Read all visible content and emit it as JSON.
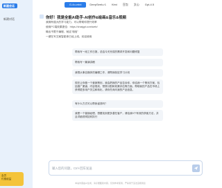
{
  "sidebar": {
    "active_item": "新建会话",
    "items": [
      {
        "label": "新建对话"
      }
    ],
    "badge": {
      "line1": "会员",
      "line2": "付费权益"
    }
  },
  "tabs": [
    {
      "label": "G-4o-mini",
      "active": true
    },
    {
      "label": "DeepSeek-r1",
      "active": false
    },
    {
      "label": "Kimi",
      "active": false
    },
    {
      "label": "豆包",
      "active": false
    },
    {
      "label": "文心",
      "active": false
    },
    {
      "label": "Gpt-4.5",
      "active": false
    }
  ],
  "hero": {
    "title": "你好！我是全能AI助手-AI创作&绘画&音乐&视频",
    "lines": [
      "我拥有强大的学习能力，可以帮助你提升效率",
      "使用PC端效果更佳：https://chatgpt.com/web/",
      "输出不限于编程，就这“相信”",
      "一键在写文案智能体已经上线，欢迎使用"
    ]
  },
  "suggestions": [
    "帮我写一段工作日报，总结今天完成的需求开发和问题修复",
    "帮我写一篇演讲稿",
    "我想从事自媒体的编辑工作，请帮我制定学习计划",
    "现在让你做一个营销策划，我会把我的产品告诉你，你给我一个策划方案，包括推广渠道、内容规划、预算分配和效果评估等方面，帮助我的产品在市场上获得更多用户关注和转化，请你先询问我的产品信息。",
    "有什么方式可以帮我省钱吗？",
    "我是一个营销经理，想要找到更多潜在客户，请给我5个有效的获客方法，并且详细说明如何执行"
  ],
  "input": {
    "placeholder": "输入您的问题，Ctrl+回车发送"
  },
  "footer": "本站内容由AI生成，请仔细甄别内容，仅供参考使用，严禁用于违法违规用途"
}
